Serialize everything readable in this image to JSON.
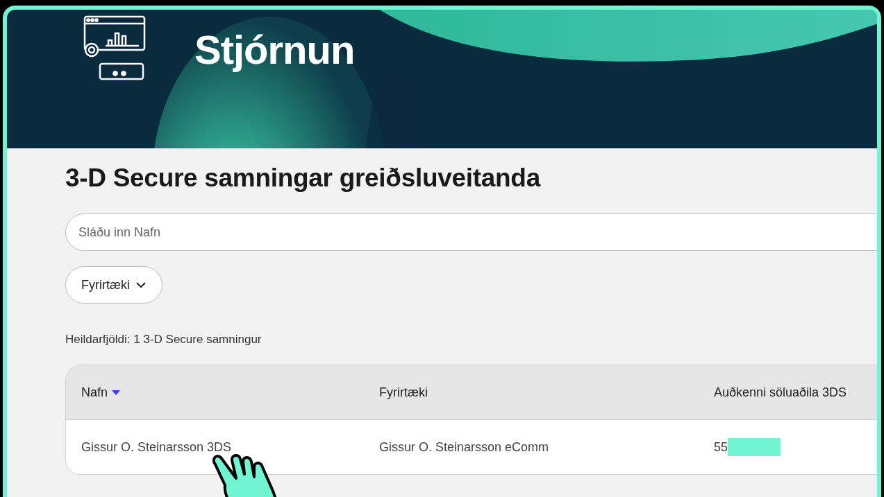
{
  "header": {
    "title": "Stjórnun"
  },
  "page": {
    "title": "3-D Secure samningar greiðsluveitanda"
  },
  "search": {
    "placeholder": "Sláðu inn Nafn"
  },
  "filters": [
    {
      "label": "Fyrirtæki",
      "expanded": false
    }
  ],
  "total": "Heildarfjöldi: 1 3-D Secure samningur",
  "table": {
    "columns": [
      {
        "label": "Nafn",
        "sorted": true
      },
      {
        "label": "Fyrirtæki",
        "sorted": false
      },
      {
        "label": "Auðkenni söluaðila 3DS",
        "sorted": false
      }
    ],
    "rows": [
      {
        "cells": [
          {
            "text": "Gissur O. Steinarsson 3DS",
            "redacted": false
          },
          {
            "text": "Gissur O. Steinarsson eComm",
            "redacted": false
          },
          {
            "text": "55",
            "redacted": true
          }
        ]
      }
    ]
  }
}
